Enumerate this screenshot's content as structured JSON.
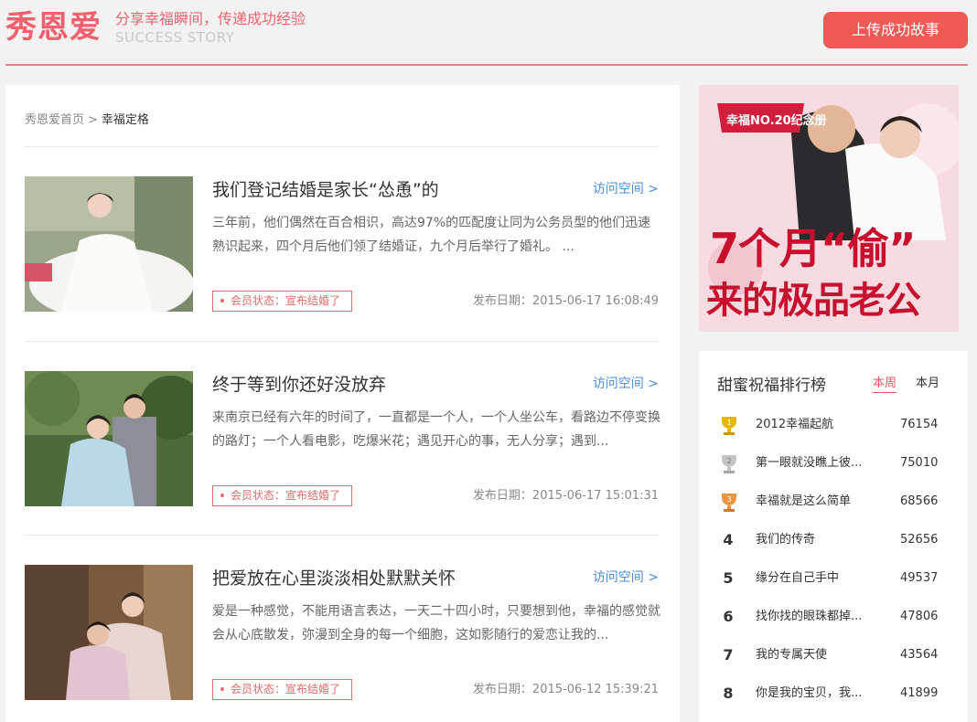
{
  "header": {
    "logo": "秀恩爱",
    "tagline": "分享幸福瞬间，传递成功经验",
    "tagline_en": "SUCCESS STORY",
    "upload_label": "上传成功故事"
  },
  "breadcrumb": {
    "home": "秀恩爱首页",
    "separator": ">",
    "current": "幸福定格"
  },
  "stories": [
    {
      "title": "我们登记结婚是家长“怂恿”的",
      "visit_label": "访问空间 >",
      "description": "三年前，他们偶然在百合相识，高达97%的匹配度让同为公务员型的他们迅速熟识起来，四个月后他们领了结婚证，九个月后举行了婚礼。 ...",
      "status": "会员状态：宣布结婚了",
      "date": "发布日期：2015-06-17 16:08:49"
    },
    {
      "title": "终于等到你还好没放弃",
      "visit_label": "访问空间 >",
      "description": "来南京已经有六年的时间了，一直都是一个人，一个人坐公车，看路边不停变换的路灯；一个人看电影，吃爆米花；遇见开心的事，无人分享；遇到...",
      "status": "会员状态：宣布结婚了",
      "date": "发布日期：2015-06-17 15:01:31"
    },
    {
      "title": "把爱放在心里淡淡相处默默关怀",
      "visit_label": "访问空间 >",
      "description": "爱是一种感觉，不能用语言表达，一天二十四小时，只要想到他，幸福的感觉就会从心底散发，弥漫到全身的每一个细胞，这如影随行的爱恋让我的...",
      "status": "会员状态：宣布结婚了",
      "date": "发布日期：2015-06-12 15:39:21"
    }
  ],
  "banner": {
    "tag": "幸福NO.20纪念册",
    "line1": "7个月“偷”",
    "line2": "来的极品老公"
  },
  "ranking": {
    "title": "甜蜜祝福排行榜",
    "tab_week": "本周",
    "tab_month": "本月",
    "items": [
      {
        "rank": "1",
        "name": "2012幸福起航",
        "score": "76154"
      },
      {
        "rank": "2",
        "name": "第一眼就没瞧上彼...",
        "score": "75010"
      },
      {
        "rank": "3",
        "name": "幸福就是这么简单",
        "score": "68566"
      },
      {
        "rank": "4",
        "name": "我们的传奇",
        "score": "52656"
      },
      {
        "rank": "5",
        "name": "缘分在自己手中",
        "score": "49537"
      },
      {
        "rank": "6",
        "name": "找你找的眼珠都掉...",
        "score": "47806"
      },
      {
        "rank": "7",
        "name": "我的专属天使",
        "score": "43564"
      },
      {
        "rank": "8",
        "name": "你是我的宝贝，我...",
        "score": "41899"
      }
    ]
  },
  "colors": {
    "accent": "#f05a55",
    "logo": "#f2606e",
    "link": "#4a8ede",
    "gold": "#e8b800",
    "silver": "#b8b8b8",
    "bronze": "#e8913a"
  }
}
